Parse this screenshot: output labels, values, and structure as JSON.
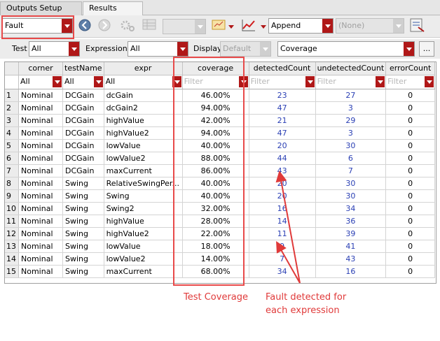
{
  "tabs": [
    {
      "label": "Outputs Setup"
    },
    {
      "label": "Results"
    }
  ],
  "toolbar": {
    "result_type": "Fault",
    "append_mode": "Append",
    "history": "(None)",
    "disabled_combo": ""
  },
  "filters": {
    "test_label": "Test",
    "test_value": "All",
    "expression_label": "Expression",
    "expression_value": "All",
    "display_label": "Display",
    "display_value": "Default",
    "view_value": "Coverage",
    "more_label": "..."
  },
  "table": {
    "columns": [
      {
        "label": "corner",
        "filter": "All",
        "placeholder": ""
      },
      {
        "label": "testName",
        "filter": "All",
        "placeholder": ""
      },
      {
        "label": "expr",
        "filter": "All",
        "placeholder": ""
      },
      {
        "label": "coverage",
        "filter": "",
        "placeholder": "Filter"
      },
      {
        "label": "detectedCount",
        "filter": "",
        "placeholder": "Filter"
      },
      {
        "label": "undetectedCount",
        "filter": "",
        "placeholder": "Filter"
      },
      {
        "label": "errorCount",
        "filter": "",
        "placeholder": "Filter"
      }
    ],
    "rows": [
      {
        "n": "1",
        "corner": "Nominal",
        "test": "DCGain",
        "expr": "dcGain",
        "coverage": "46.00%",
        "detected": "23",
        "undetected": "27",
        "error": "0"
      },
      {
        "n": "2",
        "corner": "Nominal",
        "test": "DCGain",
        "expr": "dcGain2",
        "coverage": "94.00%",
        "detected": "47",
        "undetected": "3",
        "error": "0"
      },
      {
        "n": "3",
        "corner": "Nominal",
        "test": "DCGain",
        "expr": "highValue",
        "coverage": "42.00%",
        "detected": "21",
        "undetected": "29",
        "error": "0"
      },
      {
        "n": "4",
        "corner": "Nominal",
        "test": "DCGain",
        "expr": "highValue2",
        "coverage": "94.00%",
        "detected": "47",
        "undetected": "3",
        "error": "0"
      },
      {
        "n": "5",
        "corner": "Nominal",
        "test": "DCGain",
        "expr": "lowValue",
        "coverage": "40.00%",
        "detected": "20",
        "undetected": "30",
        "error": "0"
      },
      {
        "n": "6",
        "corner": "Nominal",
        "test": "DCGain",
        "expr": "lowValue2",
        "coverage": "88.00%",
        "detected": "44",
        "undetected": "6",
        "error": "0"
      },
      {
        "n": "7",
        "corner": "Nominal",
        "test": "DCGain",
        "expr": "maxCurrent",
        "coverage": "86.00%",
        "detected": "43",
        "undetected": "7",
        "error": "0"
      },
      {
        "n": "8",
        "corner": "Nominal",
        "test": "Swing",
        "expr": "RelativeSwingPer...",
        "coverage": "40.00%",
        "detected": "20",
        "undetected": "30",
        "error": "0"
      },
      {
        "n": "9",
        "corner": "Nominal",
        "test": "Swing",
        "expr": "Swing",
        "coverage": "40.00%",
        "detected": "20",
        "undetected": "30",
        "error": "0"
      },
      {
        "n": "10",
        "corner": "Nominal",
        "test": "Swing",
        "expr": "Swing2",
        "coverage": "32.00%",
        "detected": "16",
        "undetected": "34",
        "error": "0"
      },
      {
        "n": "11",
        "corner": "Nominal",
        "test": "Swing",
        "expr": "highValue",
        "coverage": "28.00%",
        "detected": "14",
        "undetected": "36",
        "error": "0"
      },
      {
        "n": "12",
        "corner": "Nominal",
        "test": "Swing",
        "expr": "highValue2",
        "coverage": "22.00%",
        "detected": "11",
        "undetected": "39",
        "error": "0"
      },
      {
        "n": "13",
        "corner": "Nominal",
        "test": "Swing",
        "expr": "lowValue",
        "coverage": "18.00%",
        "detected": "9",
        "undetected": "41",
        "error": "0"
      },
      {
        "n": "14",
        "corner": "Nominal",
        "test": "Swing",
        "expr": "lowValue2",
        "coverage": "14.00%",
        "detected": "7",
        "undetected": "43",
        "error": "0"
      },
      {
        "n": "15",
        "corner": "Nominal",
        "test": "Swing",
        "expr": "maxCurrent",
        "coverage": "68.00%",
        "detected": "34",
        "undetected": "16",
        "error": "0"
      }
    ]
  },
  "annotations": {
    "test_coverage": "Test Coverage",
    "fault_detected_line1": "Fault detected for",
    "fault_detected_line2": "each expression",
    "color": "#e03a3a"
  },
  "colors": {
    "accent_red": "#b01818",
    "count_blue": "#2a3fb4"
  }
}
